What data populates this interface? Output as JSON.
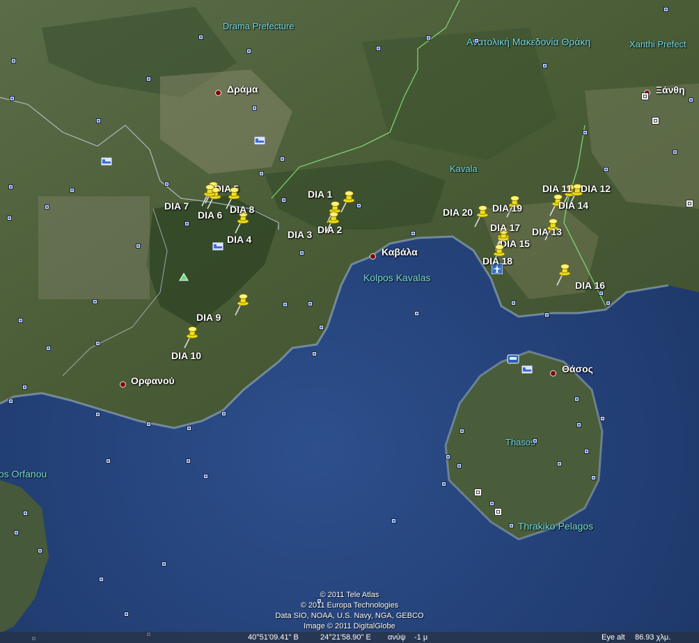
{
  "regions": {
    "drama_prefecture": "Drama Prefecture",
    "anatoliki": "Ανατολική Μακεδονία Θράκη",
    "xanthi_prefecture": "Xanthi Prefect",
    "kavala_region": "Kavala",
    "thasos_island": "Thasos"
  },
  "cities": {
    "drama": "Δράμα",
    "xanthi": "Ξάνθη",
    "kavala": "Καβάλα",
    "orfanou": "Ορφανού",
    "thasos": "Θάσος"
  },
  "water": {
    "kolpos_kavalas": "Kolpos Kavalas",
    "orfanou_gulf": "os Orfanou",
    "thrakiko_pelagos": "Thrakiko Pelagos"
  },
  "placemarks": [
    {
      "label": "DIA 1"
    },
    {
      "label": "DIA 2"
    },
    {
      "label": "DIA 3"
    },
    {
      "label": "DIA 4"
    },
    {
      "label": "DIA 5"
    },
    {
      "label": "DIA 6"
    },
    {
      "label": "DIA 7"
    },
    {
      "label": "DIA 8"
    },
    {
      "label": "DIA 9"
    },
    {
      "label": "DIA 10"
    },
    {
      "label": "DIA 11"
    },
    {
      "label": "DIA 12"
    },
    {
      "label": "DIA 13"
    },
    {
      "label": "DIA 14"
    },
    {
      "label": "DIA 15"
    },
    {
      "label": "DIA 16"
    },
    {
      "label": "DIA 17"
    },
    {
      "label": "DIA 18"
    },
    {
      "label": "DIA 19"
    },
    {
      "label": "DIA 20"
    }
  ],
  "credits": [
    "© 2011 Tele Atlas",
    "© 2011 Europa Technologies",
    "Data SIO, NOAA, U.S. Navy, NGA, GEBCO",
    "Image © 2011 DigitalGlobe"
  ],
  "status": {
    "lat": "40°51'09.41\" B",
    "lon": "24°21'58.90\" E",
    "elev_label": "ανύψ",
    "elev_value": "-1 μ",
    "eye_label": "Eye alt",
    "eye_value": "86.93 χλμ."
  },
  "icons": {
    "placemark": "yellow-pushpin-icon",
    "poi": "blue-square-poi-icon",
    "city": "city-dot-icon",
    "airport": "airport-icon",
    "hotel": "hotel-bed-icon",
    "park": "park-triangle-icon"
  },
  "colors": {
    "pin": "#f2e01a",
    "sea": "#27487f",
    "land": "#4f6239"
  }
}
